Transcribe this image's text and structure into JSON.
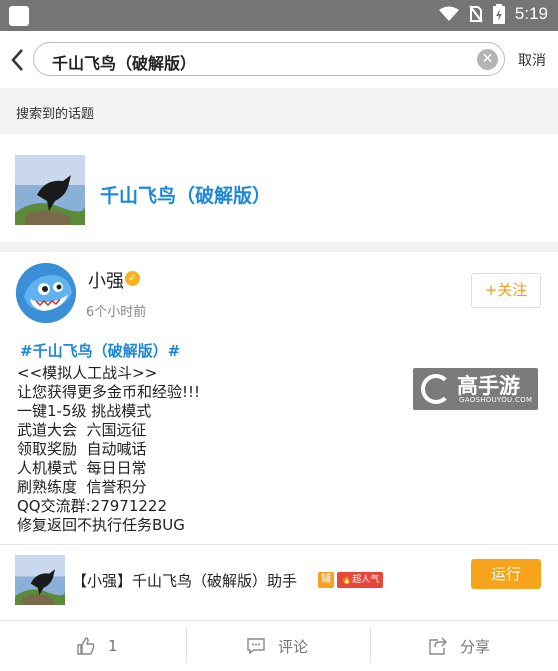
{
  "status_bar": {
    "time": "5:19",
    "icons": [
      "wifi-icon",
      "no-sim-icon",
      "battery-icon"
    ]
  },
  "search": {
    "query": "千山飞鸟（破解版）",
    "cancel_label": "取消"
  },
  "section_title": "搜索到的话题",
  "topic": {
    "title": "千山飞鸟（破解版）"
  },
  "post": {
    "author": "小强",
    "time_ago": "6个小时前",
    "follow_label": "+关注",
    "hashtag": "#千山飞鸟（破解版）#",
    "lines": [
      "<<模拟人工战斗>>",
      "让您获得更多金币和经验!!!",
      "一键1-5级 挑战模式",
      "武道大会  六国远征",
      "领取奖励  自动喊话",
      "人机模式  每日日常",
      "刷熟练度  信誉积分",
      "QQ交流群:27971222",
      "修复返回不执行任务BUG"
    ],
    "watermark": {
      "cn": "高手游",
      "en": "GAOSHOUYOU.COM"
    },
    "app": {
      "name": "【小强】千山飞鸟（破解版）助手",
      "tag_fu": "辅",
      "tag_hot": "超人气",
      "run_label": "运行"
    }
  },
  "actions": {
    "like_count": "1",
    "comment_label": "评论",
    "share_label": "分享"
  },
  "colors": {
    "link": "#1e88d8",
    "accent": "#f7a31b",
    "status_bar": "#757575"
  }
}
